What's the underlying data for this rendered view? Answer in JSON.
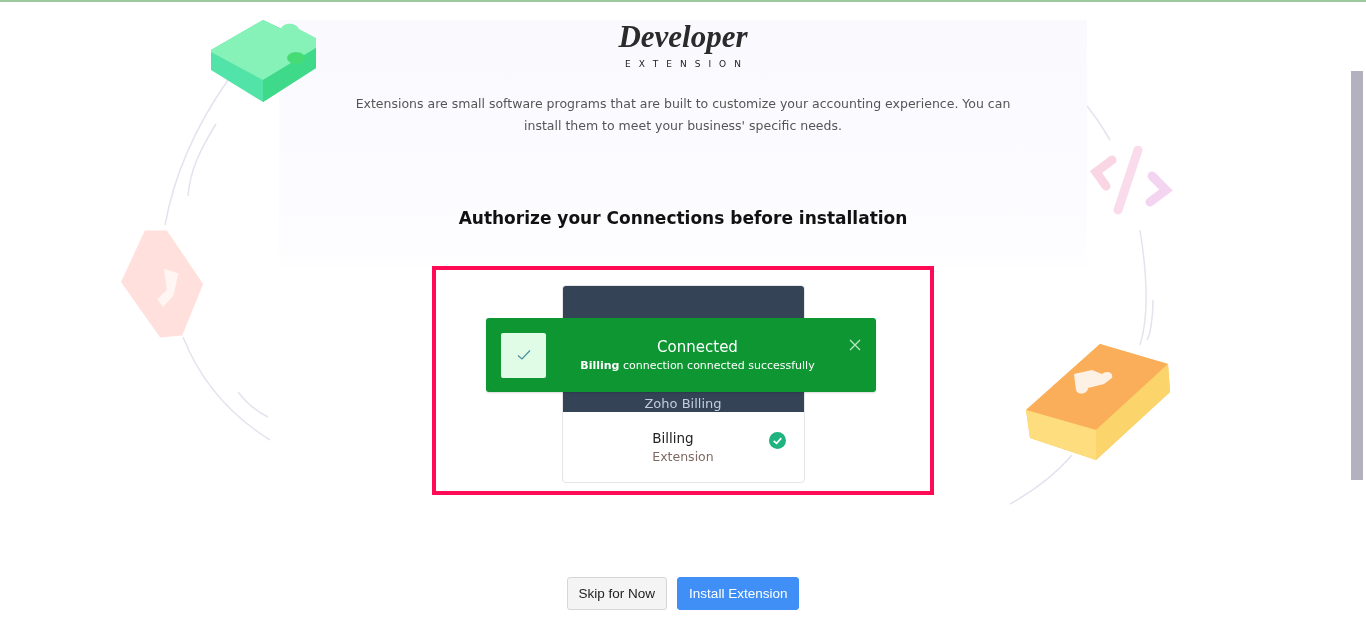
{
  "logo": {
    "title": "Developer",
    "subtitle": "EXTENSION"
  },
  "description": "Extensions are small software programs that are built to customize your accounting experience. You can install them to meet your business' specific needs.",
  "heading": "Authorize your Connections before installation",
  "connection_card": {
    "service": "Zoho Billing",
    "name": "Billing",
    "type": "Extension",
    "authorized": true
  },
  "toast": {
    "title": "Connected",
    "message": "**Billing** connection connected successfully"
  },
  "buttons": [
    {
      "label": "Skip for Now",
      "kind": "secondary"
    },
    {
      "label": "Install Extension",
      "kind": "primary"
    }
  ]
}
